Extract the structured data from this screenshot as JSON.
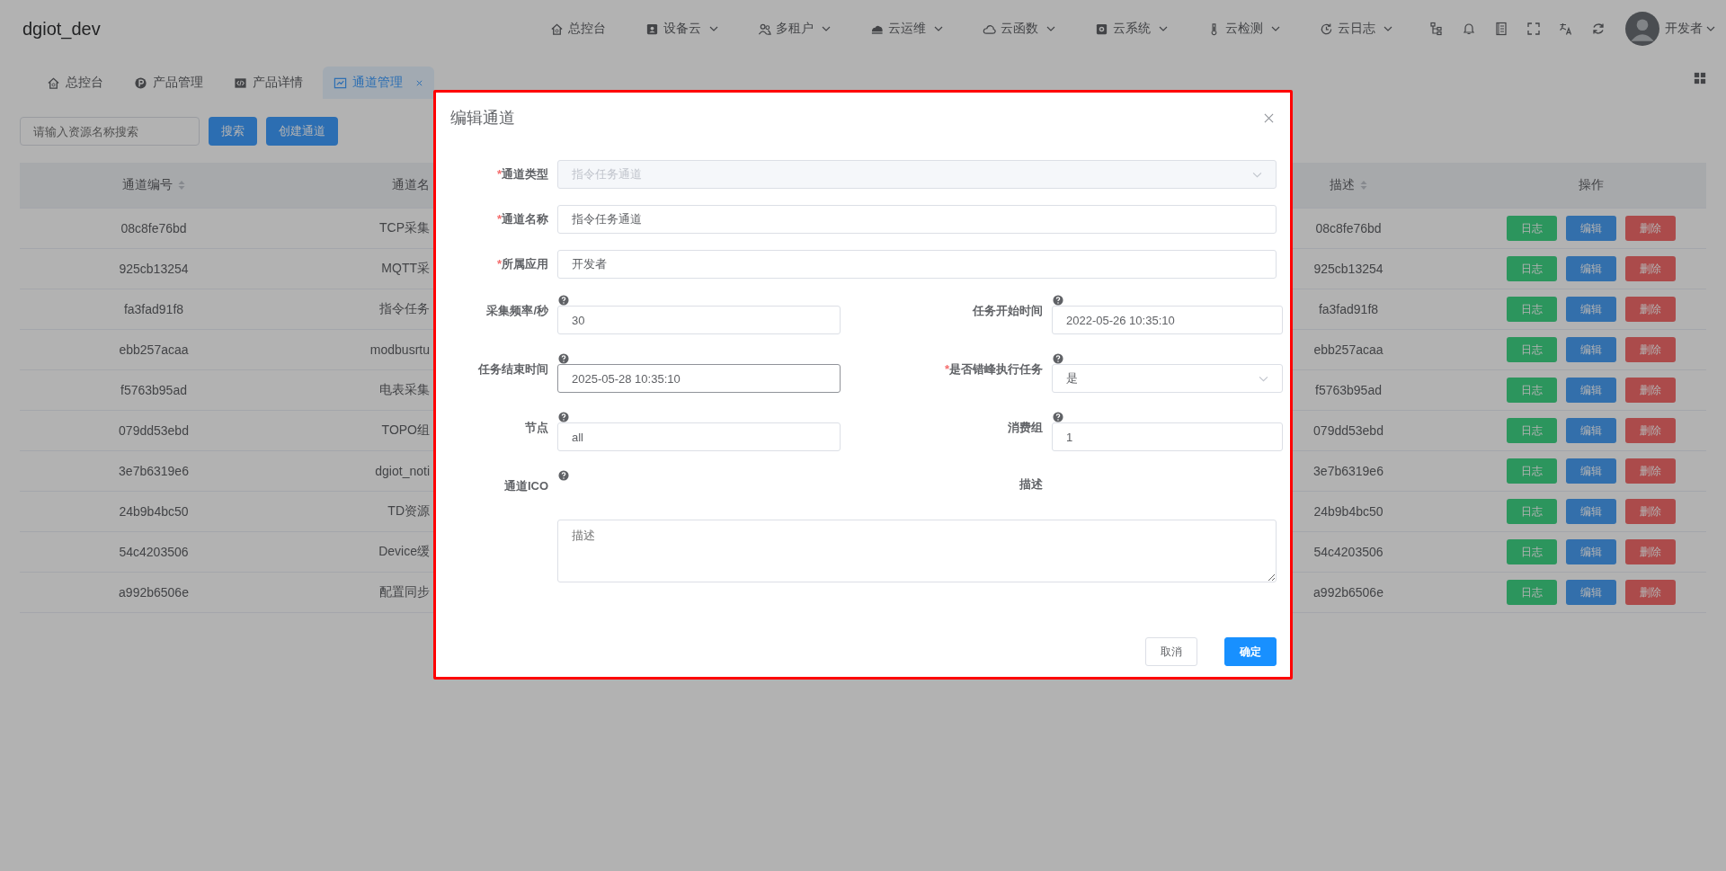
{
  "header": {
    "brand": "dgiot_dev",
    "nav": [
      {
        "label": "总控台",
        "caret": false
      },
      {
        "label": "设备云",
        "caret": true
      },
      {
        "label": "多租户",
        "caret": true
      },
      {
        "label": "云运维",
        "caret": true
      },
      {
        "label": "云函数",
        "caret": true
      },
      {
        "label": "云系统",
        "caret": true
      },
      {
        "label": "云检测",
        "caret": true
      },
      {
        "label": "云日志",
        "caret": true
      }
    ],
    "user": "开发者"
  },
  "tabs": [
    {
      "label": "总控台",
      "selected": false,
      "closable": false
    },
    {
      "label": "产品管理",
      "selected": false,
      "closable": false
    },
    {
      "label": "产品详情",
      "selected": false,
      "closable": false
    },
    {
      "label": "通道管理",
      "selected": true,
      "closable": true
    }
  ],
  "search": {
    "placeholder": "请输入资源名称搜索",
    "buttons": [
      "搜索",
      "创建通道"
    ]
  },
  "table": {
    "columns": [
      {
        "label": "通道编号",
        "sortable": true
      },
      {
        "label": "通道名",
        "sortable": false
      },
      {
        "label": "描述",
        "sortable": true
      },
      {
        "label": "操作",
        "sortable": false
      }
    ],
    "rows": [
      {
        "id": "08c8fe76bd",
        "name": "TCP采集",
        "description": "08c8fe76bd",
        "actions": [
          {
            "label": "日志",
            "kind": "log"
          },
          {
            "label": "编辑",
            "kind": "edit"
          },
          {
            "label": "删除",
            "kind": "delete"
          }
        ]
      },
      {
        "id": "925cb13254",
        "name": "MQTT采",
        "description": "925cb13254",
        "actions": [
          {
            "label": "日志",
            "kind": "log"
          },
          {
            "label": "编辑",
            "kind": "edit"
          },
          {
            "label": "删除",
            "kind": "delete"
          }
        ]
      },
      {
        "id": "fa3fad91f8",
        "name": "指令任务",
        "description": "fa3fad91f8",
        "actions": [
          {
            "label": "日志",
            "kind": "log"
          },
          {
            "label": "编辑",
            "kind": "edit"
          },
          {
            "label": "删除",
            "kind": "delete"
          }
        ]
      },
      {
        "id": "ebb257acaa",
        "name": "modbusrtu",
        "description": "ebb257acaa",
        "actions": [
          {
            "label": "日志",
            "kind": "log"
          },
          {
            "label": "编辑",
            "kind": "edit"
          },
          {
            "label": "删除",
            "kind": "delete"
          }
        ]
      },
      {
        "id": "f5763b95ad",
        "name": "电表采集",
        "description": "f5763b95ad",
        "actions": [
          {
            "label": "日志",
            "kind": "log"
          },
          {
            "label": "编辑",
            "kind": "edit"
          },
          {
            "label": "删除",
            "kind": "delete"
          }
        ]
      },
      {
        "id": "079dd53ebd",
        "name": "TOPO组",
        "description": "079dd53ebd",
        "actions": [
          {
            "label": "日志",
            "kind": "log"
          },
          {
            "label": "编辑",
            "kind": "edit"
          },
          {
            "label": "删除",
            "kind": "delete"
          }
        ]
      },
      {
        "id": "3e7b6319e6",
        "name": "dgiot_noti",
        "description": "3e7b6319e6",
        "actions": [
          {
            "label": "日志",
            "kind": "log"
          },
          {
            "label": "编辑",
            "kind": "edit"
          },
          {
            "label": "删除",
            "kind": "delete"
          }
        ]
      },
      {
        "id": "24b9b4bc50",
        "name": "TD资源",
        "description": "24b9b4bc50",
        "actions": [
          {
            "label": "日志",
            "kind": "log"
          },
          {
            "label": "编辑",
            "kind": "edit"
          },
          {
            "label": "删除",
            "kind": "delete"
          }
        ]
      },
      {
        "id": "54c4203506",
        "name": "Device缓",
        "description": "54c4203506",
        "actions": [
          {
            "label": "日志",
            "kind": "log"
          },
          {
            "label": "编辑",
            "kind": "edit"
          },
          {
            "label": "删除",
            "kind": "delete"
          }
        ]
      },
      {
        "id": "a992b6506e",
        "name": "配置同步",
        "description": "a992b6506e",
        "actions": [
          {
            "label": "日志",
            "kind": "log"
          },
          {
            "label": "编辑",
            "kind": "edit"
          },
          {
            "label": "删除",
            "kind": "delete"
          }
        ]
      }
    ]
  },
  "dialog": {
    "title": "编辑通道",
    "rows": [
      [
        {
          "kind": "select",
          "required": true,
          "mark": "*",
          "label": "通道类型",
          "help": false,
          "value": "指令任务通道",
          "disabled": true,
          "focused": false
        }
      ],
      [
        {
          "kind": "input",
          "required": true,
          "mark": "*",
          "label": "通道名称",
          "help": false,
          "value": "指令任务通道",
          "disabled": false,
          "focused": false
        }
      ],
      [
        {
          "kind": "input",
          "required": true,
          "mark": "*",
          "label": "所属应用",
          "help": false,
          "value": "开发者",
          "disabled": false,
          "focused": false
        }
      ],
      [
        {
          "kind": "input",
          "required": false,
          "label": "采集频率/秒",
          "help": true,
          "value": "30",
          "disabled": false,
          "focused": false
        },
        {
          "kind": "input",
          "required": false,
          "label": "任务开始时间",
          "help": true,
          "value": "2022-05-26 10:35:10",
          "disabled": false,
          "focused": false
        }
      ],
      [
        {
          "kind": "input",
          "required": false,
          "label": "任务结束时间",
          "help": true,
          "value": "2025-05-28 10:35:10",
          "disabled": false,
          "focused": true
        },
        {
          "kind": "select",
          "required": true,
          "mark": "*",
          "label": "是否错峰执行任务",
          "help": true,
          "value": "是",
          "disabled": false,
          "focused": false
        }
      ],
      [
        {
          "kind": "input",
          "required": false,
          "label": "节点",
          "help": true,
          "value": "all",
          "disabled": false,
          "focused": false
        },
        {
          "kind": "input",
          "required": false,
          "label": "消费组",
          "help": true,
          "value": "1",
          "disabled": false,
          "focused": false
        }
      ],
      [
        {
          "kind": "label",
          "required": false,
          "label": "通道ICO",
          "help": true
        },
        {
          "kind": "label",
          "required": false,
          "label": "描述",
          "help": false
        }
      ],
      [
        {
          "kind": "textarea",
          "placeholder": "描述"
        }
      ]
    ],
    "buttons": [
      {
        "label": "取消",
        "kind": "default"
      },
      {
        "label": "确定",
        "kind": "primary"
      }
    ]
  }
}
